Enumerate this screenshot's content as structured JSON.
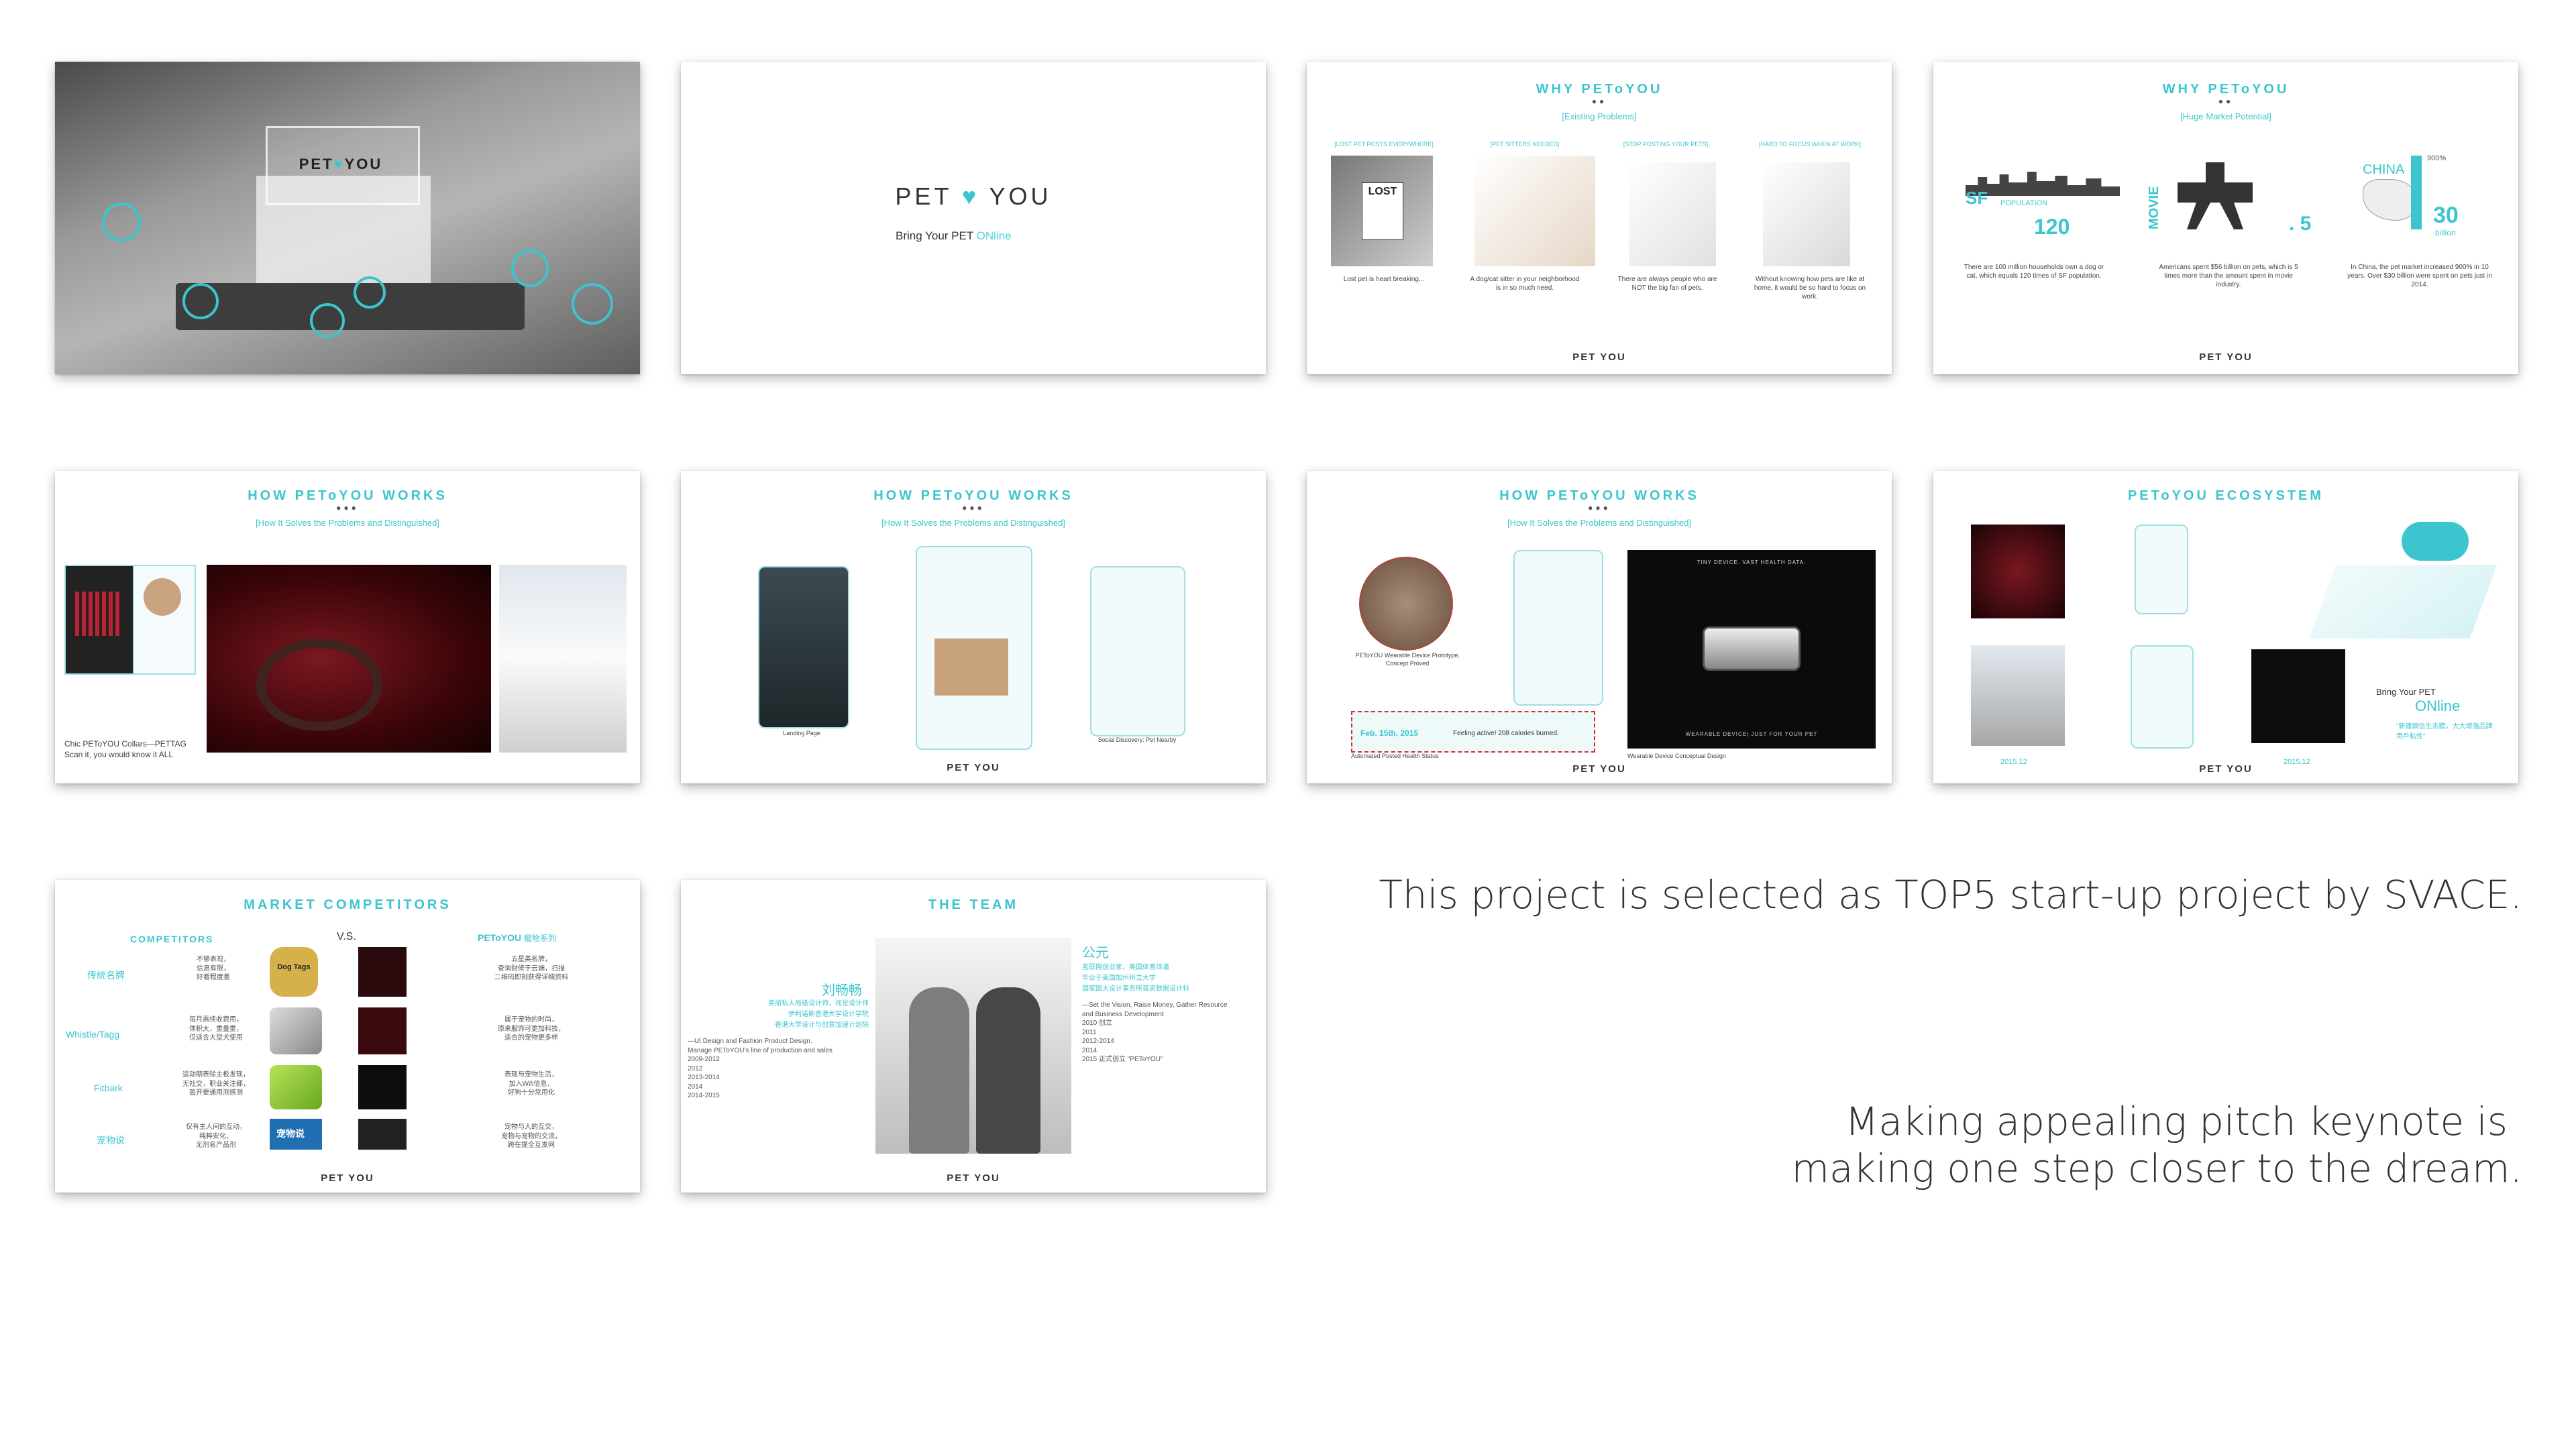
{
  "colors": {
    "accent": "#3cc5cf",
    "text": "#333333"
  },
  "slide1": {
    "logo": "PET",
    "logo2": "YOU"
  },
  "slide2": {
    "logo": "PET",
    "logo2": "YOU",
    "tagline_a": "Bring Your PET",
    "tagline_b": "ONline"
  },
  "slide3": {
    "title": "WHY PEToYOU",
    "subtitle": "[Existing Problems]",
    "headers": [
      "[LOST PET POSTS EVERYWHERE]",
      "[PET SITTERS NEEDED]",
      "[STOP POSTING YOUR PETS]",
      "[HARD TO FOCUS WHEN AT WORK]"
    ],
    "captions": [
      "Lost pet is heart breaking...",
      "A dog/cat sitter in your neighborhood is in so much need.",
      "There are always people who are NOT the big fan of pets.",
      "Without knowing how pets are like at home, it would be so hard to focus on work."
    ],
    "sign": "LOST",
    "logo": "PET YOU"
  },
  "slide4": {
    "title": "WHY PEToYOU",
    "subtitle": "[Huge Market Potential]",
    "sf": "SF",
    "population": "POPULATION",
    "num1": "120",
    "movie": "MOVIE",
    "num2": ". 5",
    "china": "CHINA",
    "pct": "900%",
    "num3": "30",
    "billion": "billion",
    "cap1": "There are 100 million households own a dog or cat, which equals 120 times of SF population.",
    "cap2": "Americans spent $56 billion on pets, which is 5 times more than the amount spent in movie industry.",
    "cap3": "In China, the pet market increased 900% in 10 years. Over $30 billion were spent on pets just in 2014.",
    "logo": "PET YOU"
  },
  "slide5": {
    "title": "HOW PEToYOU WORKS",
    "subtitle": "[How It Solves the Problems and Distinguished]",
    "caption": "Chic PEToYOU Collars—PETTAG Scan it, you would know it ALL"
  },
  "slide6": {
    "title": "HOW PEToYOU WORKS",
    "subtitle": "[How It Solves the Problems and Distinguished]",
    "cap_left": "Landing Page",
    "cap_right": "Social Discovery: Pet Nearby",
    "logo": "PET YOU"
  },
  "slide7": {
    "title": "HOW PEToYOU WORKS",
    "subtitle": "[How It Solves the Problems and Distinguished]",
    "cap_proto": "PEToYOU Wearable Device Prototype, Concept Proved",
    "date": "Feb. 15th, 2015",
    "feeling": "Feeling active! 208 calories burned.",
    "cap_status": "Automated Posted Health Status",
    "cap_device": "Wearable Device Conceptual Design",
    "device_top": "TINY DEVICE. VAST HEALTH DATA.",
    "device_bottom": "WEARABLE DEVICE| JUST FOR YOUR PET",
    "logo": "PET YOU"
  },
  "slide8": {
    "title": "PEToYOU ECOSYSTEM",
    "bring": "Bring Your PET",
    "online": "ONline",
    "chinese": "\"新建網信生态體，大大增強品牌用戶粘性\"",
    "date1": "2015.12",
    "date2": "2015.12",
    "logo": "PET YOU"
  },
  "slide9": {
    "title": "MARKET COMPETITORS",
    "left_head": "COMPETITORS",
    "vs": "V.S.",
    "right_head": "PEToYOU",
    "right_head2": "寵物系列",
    "rows": [
      {
        "name": "传统名牌",
        "left": "不够表现，\n信息有限，\n好看程度差",
        "right": "五星类名牌，\n查询财修于云端，扫描\n二维码即刻获得详细资料"
      },
      {
        "name": "Whistle/Tagg",
        "left": "每月需续收费用，\n体积大，重量重，\n仅适合大型犬使用",
        "right": "属于宠物的时尚，\n原来服饰可更加科技，\n适合的宠物更多样"
      },
      {
        "name": "Fitbark",
        "left": "运动期表除主板发现，\n无社交，职业关注都，\n盈开要通用测感测",
        "right": "表现与宠物生活，\n加入Wifi信息，\n好狗十分常用化"
      },
      {
        "name": "宠物说",
        "left": "仅有主人间的互动，\n纯粹安化，\n无剂名产品剂",
        "right": "宠物与人的互交，\n宠物与宠物的交流，\n跨在提全互发网"
      }
    ],
    "tag": "Dog Tags",
    "app": "宠物说",
    "logo": "PET YOU"
  },
  "slide10": {
    "title": "THE TEAM",
    "name1": "刘畅畅",
    "name2": "公元",
    "logo": "PET YOU",
    "left_lines": [
      "美丽私人局级设计师，视觉设计师",
      "伊利诺斯香港大学设计学院",
      "香港大学设计与创意加速计划院"
    ],
    "left_cv": "—UI Design and Fashion Product Design.\nManage PEToYOU's line of production and sales\n2009-2012\n2012\n2013-2014\n2014\n2014-2015",
    "right_lines": [
      "互联网创业家，美国体育体道",
      "毕业于美国加州州立大学",
      "国家国大设计事务所首席数据设计科"
    ],
    "right_cv": "—Set the Vision, Raise Money, Gather Resource\nand Business Development\n2010  创立\n2011\n2012-2014\n2014\n2015  正式创立 \"PEToYOU\""
  },
  "text1": "This project is selected as TOP5 start-up project by SVACE.",
  "text2a": "Making appealing pitch keynote is",
  "text2b": "making one step closer to the dream."
}
